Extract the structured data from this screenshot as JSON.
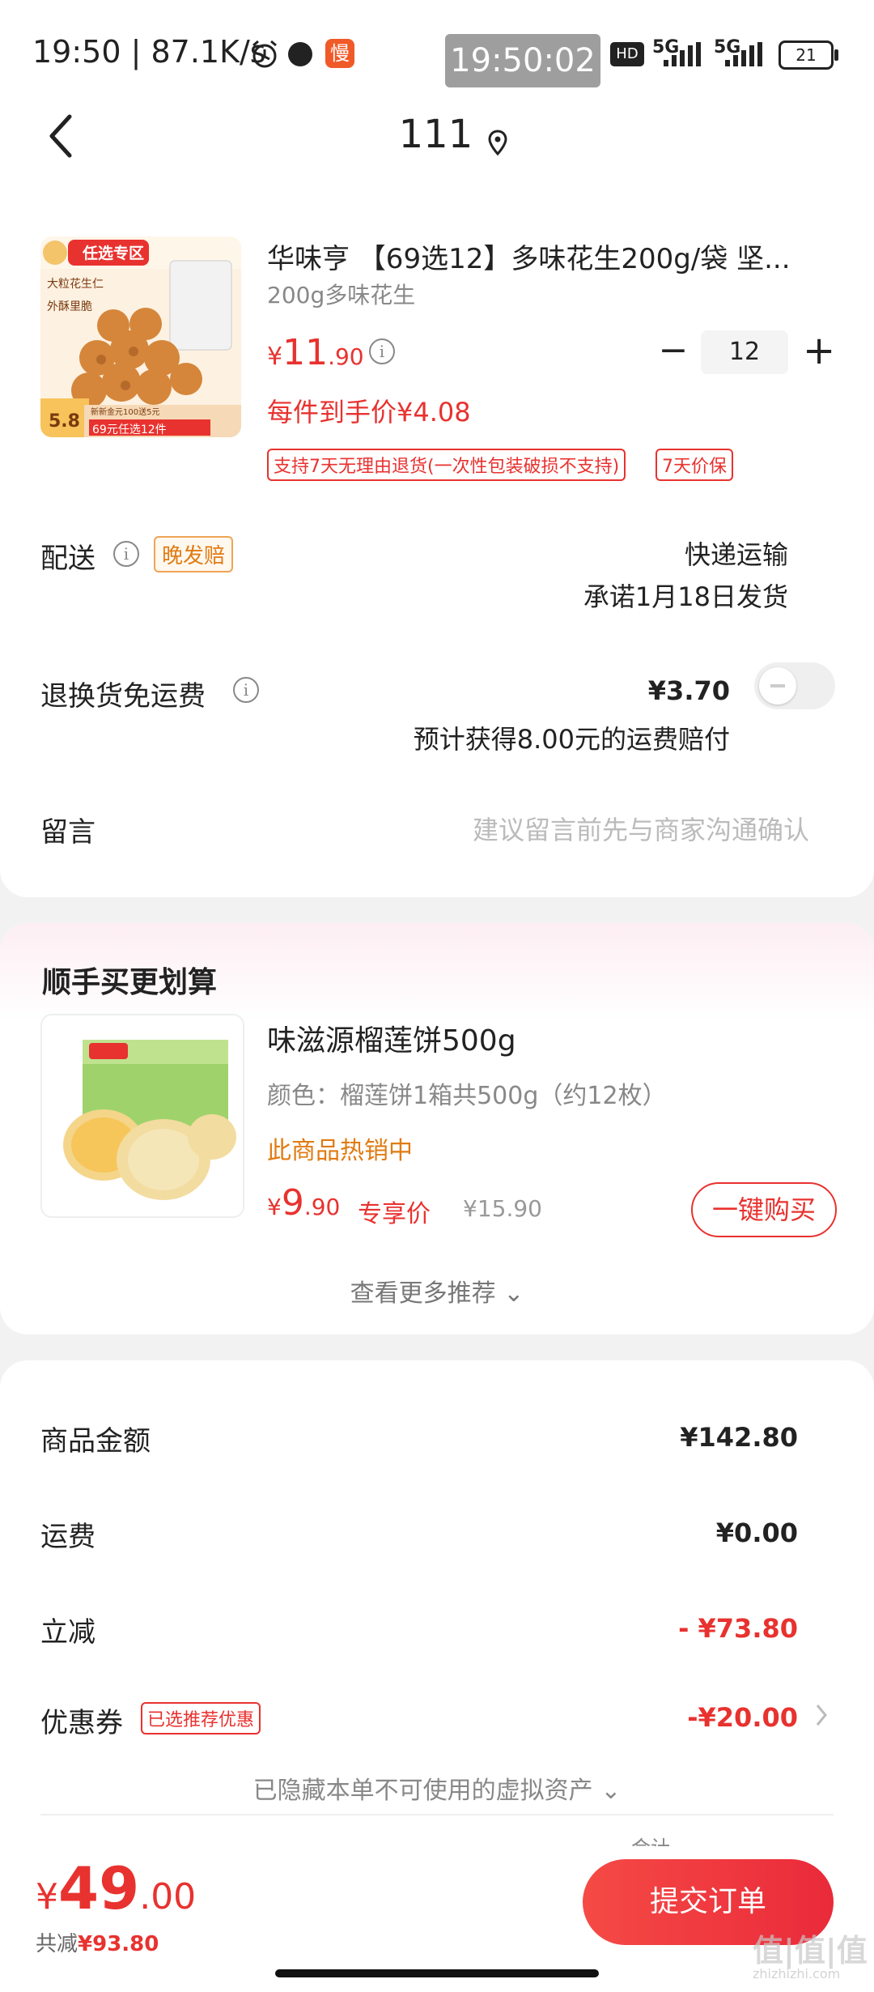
{
  "status_bar": {
    "time": "19:50 | 87.1K/s",
    "clock": "19:50:02",
    "hd": "HD",
    "net1": "5G",
    "net2": "5G",
    "battery": "21",
    "app_badge": "慢"
  },
  "header": {
    "title": "111"
  },
  "product": {
    "title": "华味亨 【69选12】多味花生200g/袋 坚...",
    "spec": "200g多味花生",
    "price_currency": "¥",
    "price_int": "11",
    "price_dec": ".90",
    "quantity": "12",
    "per_item_price": "每件到手价¥4.08",
    "tags": [
      "支持7天无理由退货(一次性包装破损不支持)",
      "7天价保"
    ],
    "image_texts": {
      "zone": "任选专区",
      "l1": "大粒花生仁",
      "l2": "外酥里脆",
      "price": "5.8",
      "promo1": "新新金元100送5元",
      "promo2": "69元任选12件"
    }
  },
  "delivery": {
    "label": "配送",
    "badge": "晚发赔",
    "method": "快递运输",
    "promise": "承诺1月18日发货"
  },
  "return_shipping": {
    "label": "退换货免运费",
    "price": "¥3.70",
    "note": "预计获得8.00元的运费赔付"
  },
  "message": {
    "label": "留言",
    "placeholder": "建议留言前先与商家沟通确认"
  },
  "recommend": {
    "title": "顺手买更划算",
    "item_title": "味滋源榴莲饼500g",
    "item_spec": "颜色：榴莲饼1箱共500g（约12枚）",
    "hot": "此商品热销中",
    "price_currency": "¥",
    "price_int": "9",
    "price_dec": ".90",
    "price_label": "专享价",
    "orig_price": "¥15.90",
    "buy_label": "一键购买",
    "more": "查看更多推荐 ⌄"
  },
  "summary": {
    "goods_label": "商品金额",
    "goods_value": "¥142.80",
    "shipping_label": "运费",
    "shipping_value": "¥0.00",
    "discount_label": "立减",
    "discount_value": "- ¥73.80",
    "coupon_label": "优惠券",
    "coupon_badge": "已选推荐优惠",
    "coupon_value": "-¥20.00",
    "hidden_note": "已隐藏本单不可使用的虚拟资产 ⌄",
    "partial": "合计"
  },
  "bottom": {
    "total_currency": "¥",
    "total_int": "49",
    "total_dec": ".00",
    "saved_prefix": "共减",
    "saved_value": "¥93.80",
    "submit": "提交订单",
    "watermark": "值|值|值",
    "watermark_sub": "zhizhizhi.com"
  },
  "colors": {
    "accent": "#e8322f",
    "badge_orange": "#f08a1a"
  }
}
